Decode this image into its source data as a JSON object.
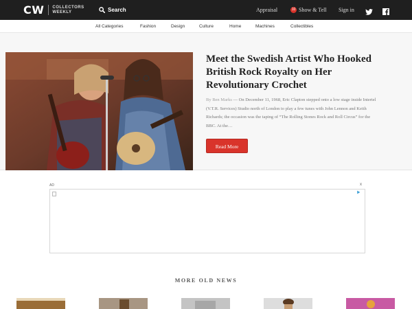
{
  "header": {
    "logo_mark": "CW",
    "logo_sub_line1": "COLLECTORS",
    "logo_sub_line2": "WEEKLY",
    "search_label": "Search",
    "search_icon": "search-icon",
    "appraisal_label": "Appraisal",
    "show_tell_count": "10",
    "show_tell_label": "Show & Tell",
    "sign_in_label": "Sign in",
    "social_icons": [
      "twitter-icon",
      "facebook-icon"
    ],
    "background_color": "#1f1f1f"
  },
  "categories": [
    "All Categories",
    "Fashion",
    "Design",
    "Culture",
    "Home",
    "Machines",
    "Collectibles"
  ],
  "hero": {
    "title": "Meet the Swedish Artist Who Hooked British Rock Royalty on Her Revolutionary Crochet",
    "author": "By Ben Marks",
    "excerpt": " — On December 11, 1968, Eric Clapton stepped onto a low stage inside Intertel (V.T.R. Services) Studio north of London to play a few tunes with John Lennon and Keith Richards; the occasion was the taping of “The Rolling Stones Rock and Roll Circus” for the BBC. At the…",
    "read_more_label": "Read More",
    "accent_color": "#d9342b"
  },
  "ad": {
    "label": "AD",
    "close": "x",
    "choices_icon": "adchoices-icon"
  },
  "more_old_news": {
    "heading": "MORE OLD NEWS"
  }
}
